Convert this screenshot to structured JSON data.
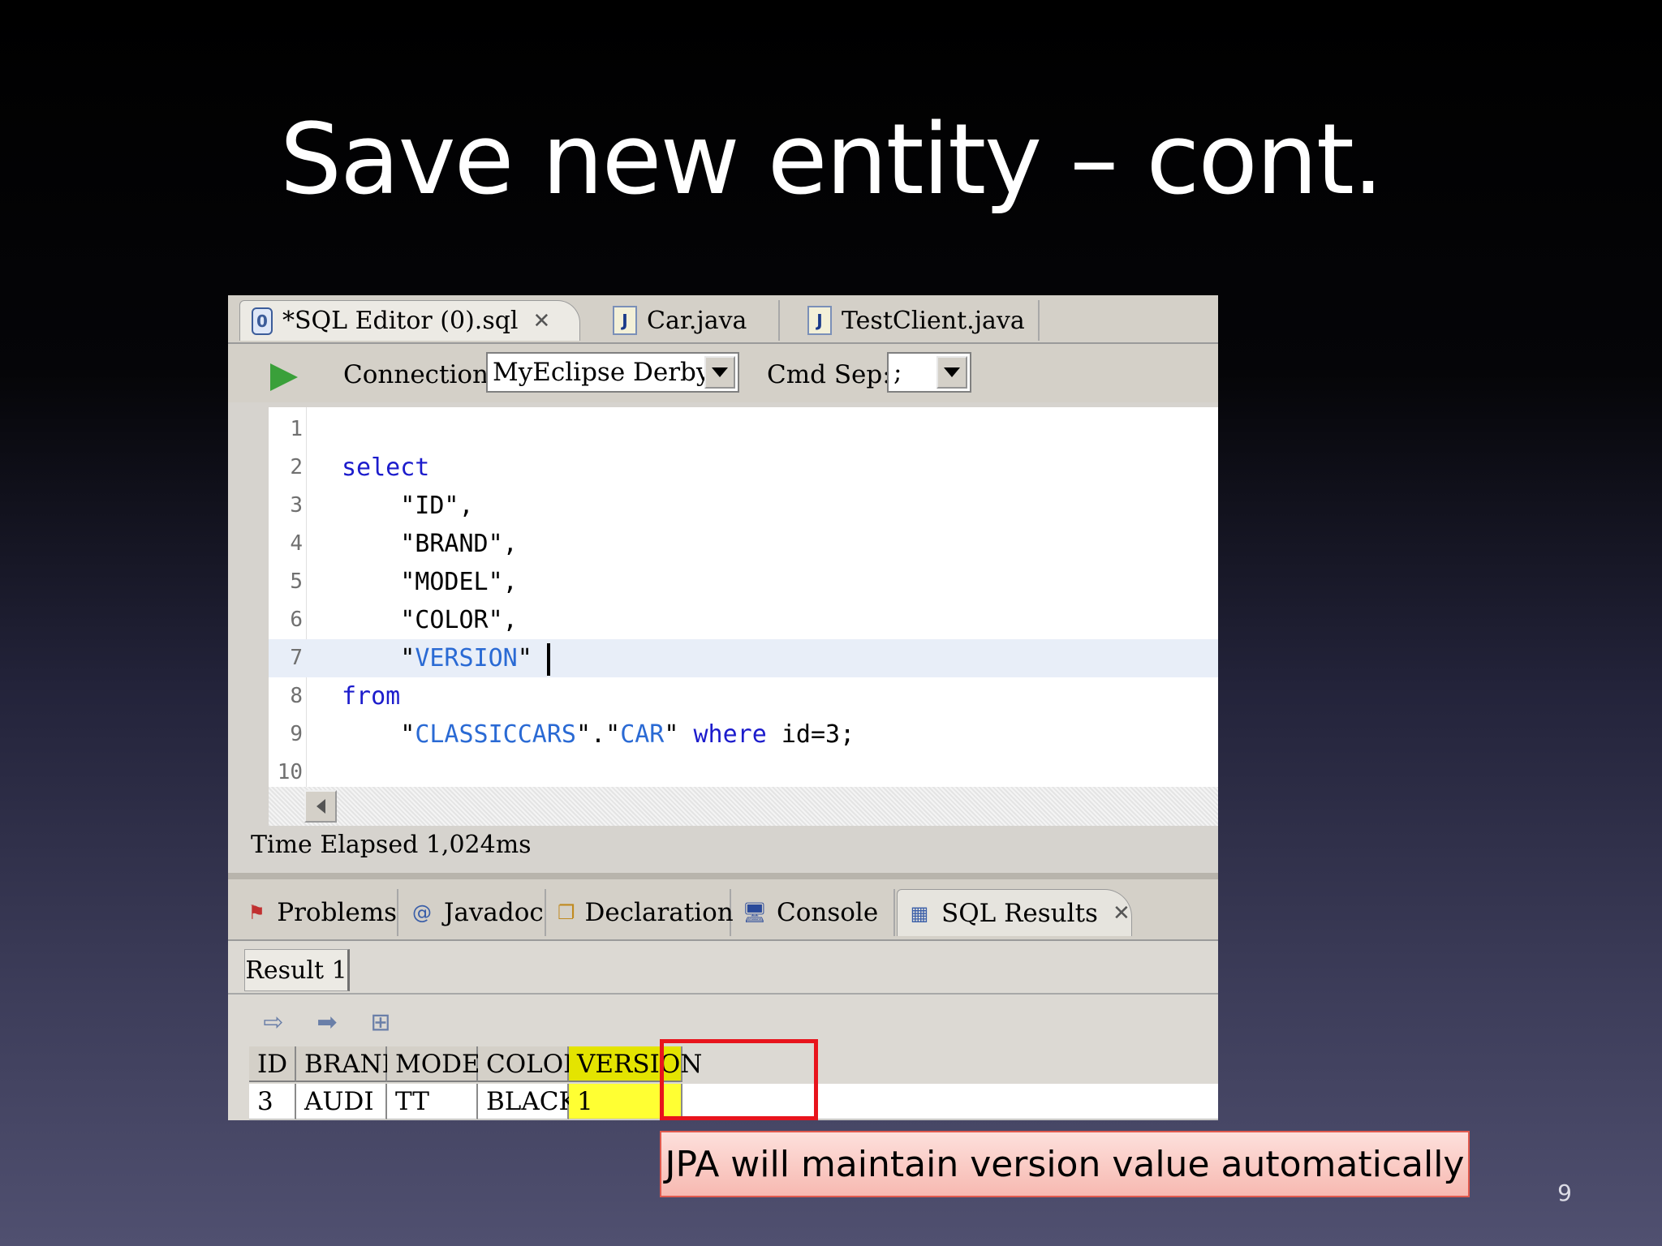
{
  "slide": {
    "title": "Save new entity – cont.",
    "page_number": "9",
    "callout": "JPA will maintain version value automatically"
  },
  "editor_tabs": [
    {
      "label": "*SQL Editor (0).sql",
      "icon": "database-icon",
      "active": true
    },
    {
      "label": "Car.java",
      "icon": "java-file-icon",
      "active": false
    },
    {
      "label": "TestClient.java",
      "icon": "java-file-warning-icon",
      "active": false
    }
  ],
  "toolbar": {
    "connection_label": "Connection:",
    "connection_value": "MyEclipse Derby",
    "cmdsep_label": "Cmd Sep:",
    "cmdsep_value": ";"
  },
  "code": {
    "line_numbers": [
      "1",
      "2",
      "3",
      "4",
      "5",
      "6",
      "7",
      "8",
      "9",
      "10"
    ],
    "lines": [
      {
        "n": "1",
        "parts": []
      },
      {
        "n": "2",
        "parts": [
          {
            "t": "select",
            "c": "kw"
          }
        ]
      },
      {
        "n": "3",
        "parts": [
          {
            "t": "    \"ID\",",
            "c": "str"
          }
        ]
      },
      {
        "n": "4",
        "parts": [
          {
            "t": "    \"BRAND\",",
            "c": "str"
          }
        ]
      },
      {
        "n": "5",
        "parts": [
          {
            "t": "    \"MODEL\",",
            "c": "str"
          }
        ]
      },
      {
        "n": "6",
        "parts": [
          {
            "t": "    \"COLOR\",",
            "c": "str"
          }
        ]
      },
      {
        "n": "7",
        "parts": [
          {
            "t": "    \"",
            "c": "str"
          },
          {
            "t": "VERSION",
            "c": "ident"
          },
          {
            "t": "\"",
            "c": "str"
          }
        ]
      },
      {
        "n": "8",
        "parts": [
          {
            "t": "from",
            "c": "kw"
          }
        ]
      },
      {
        "n": "9",
        "parts": [
          {
            "t": "    \"",
            "c": "str"
          },
          {
            "t": "CLASSICCARS",
            "c": "ident"
          },
          {
            "t": "\".\"",
            "c": "str"
          },
          {
            "t": "CAR",
            "c": "ident"
          },
          {
            "t": "\" ",
            "c": "str"
          },
          {
            "t": "where",
            "c": "kw"
          },
          {
            "t": " id=3;",
            "c": "str"
          }
        ]
      },
      {
        "n": "10",
        "parts": []
      }
    ]
  },
  "status": {
    "elapsed": "Time Elapsed 1,024ms"
  },
  "view_tabs": [
    {
      "label": "Problems",
      "icon": "problems-icon"
    },
    {
      "label": "Javadoc",
      "icon": "at-icon"
    },
    {
      "label": "Declaration",
      "icon": "declaration-icon"
    },
    {
      "label": "Console",
      "icon": "monitor-icon"
    },
    {
      "label": "SQL Results",
      "icon": "table-icon",
      "active": true
    }
  ],
  "results": {
    "tab_label": "Result 1",
    "columns": [
      "ID",
      "BRAND",
      "MODEL",
      "COLOR",
      "VERSION"
    ],
    "rows": [
      [
        "3",
        "AUDI",
        "TT",
        "BLACK",
        "1"
      ]
    ]
  },
  "colors": {
    "highlight": "#ffff33",
    "box_border": "#e8141c",
    "keyword": "#1c1ccc",
    "identifier": "#2a6ad4"
  }
}
